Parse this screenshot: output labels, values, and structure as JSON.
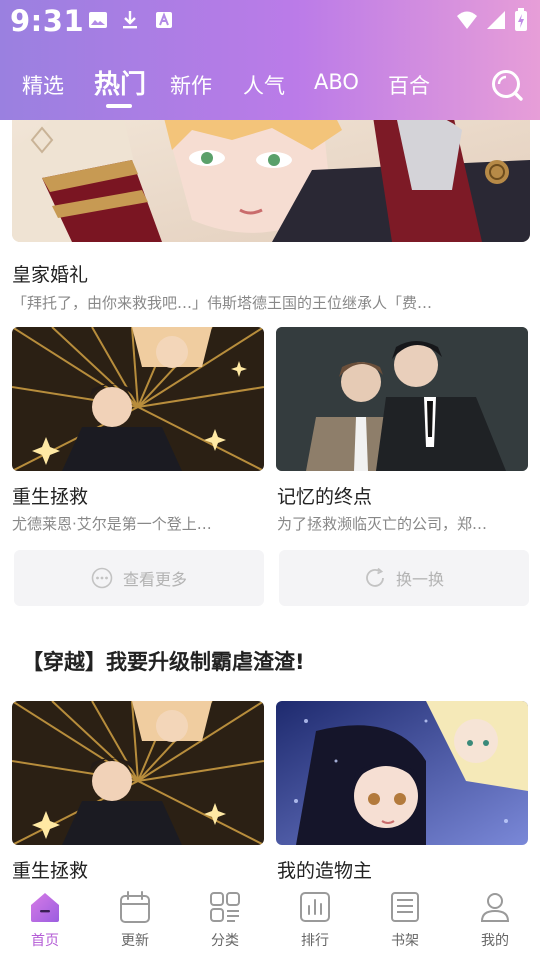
{
  "status_bar": {
    "time": "9:31"
  },
  "tabs": [
    {
      "label": "精选"
    },
    {
      "label": "热门"
    },
    {
      "label": "新作"
    },
    {
      "label": "人气"
    },
    {
      "label": "ABO"
    },
    {
      "label": "百合"
    }
  ],
  "active_tab": "热门",
  "featured": {
    "title": "皇家婚礼",
    "desc": "「拜托了，由你来救我吧…」伟斯塔德王国的王位继承人「费…"
  },
  "cards_row1": [
    {
      "title": "重生拯救",
      "desc": "尤德莱恩·艾尔是第一个登上…"
    },
    {
      "title": "记忆的终点",
      "desc": "为了拯救濒临灭亡的公司，郑…"
    }
  ],
  "actions": {
    "more": "查看更多",
    "refresh": "换一换"
  },
  "section2": {
    "title": "【穿越】我要升级制霸虐渣渣!",
    "cards": [
      {
        "title": "重生拯救"
      },
      {
        "title": "我的造物主"
      }
    ]
  },
  "bottom_nav": [
    {
      "label": "首页",
      "icon": "home-icon"
    },
    {
      "label": "更新",
      "icon": "calendar-icon"
    },
    {
      "label": "分类",
      "icon": "category-icon"
    },
    {
      "label": "排行",
      "icon": "ranking-icon"
    },
    {
      "label": "书架",
      "icon": "bookshelf-icon"
    },
    {
      "label": "我的",
      "icon": "profile-icon"
    }
  ],
  "colors": {
    "accent": "#b45cd6",
    "header_start": "#9a80e0",
    "header_end": "#e79ed8"
  }
}
